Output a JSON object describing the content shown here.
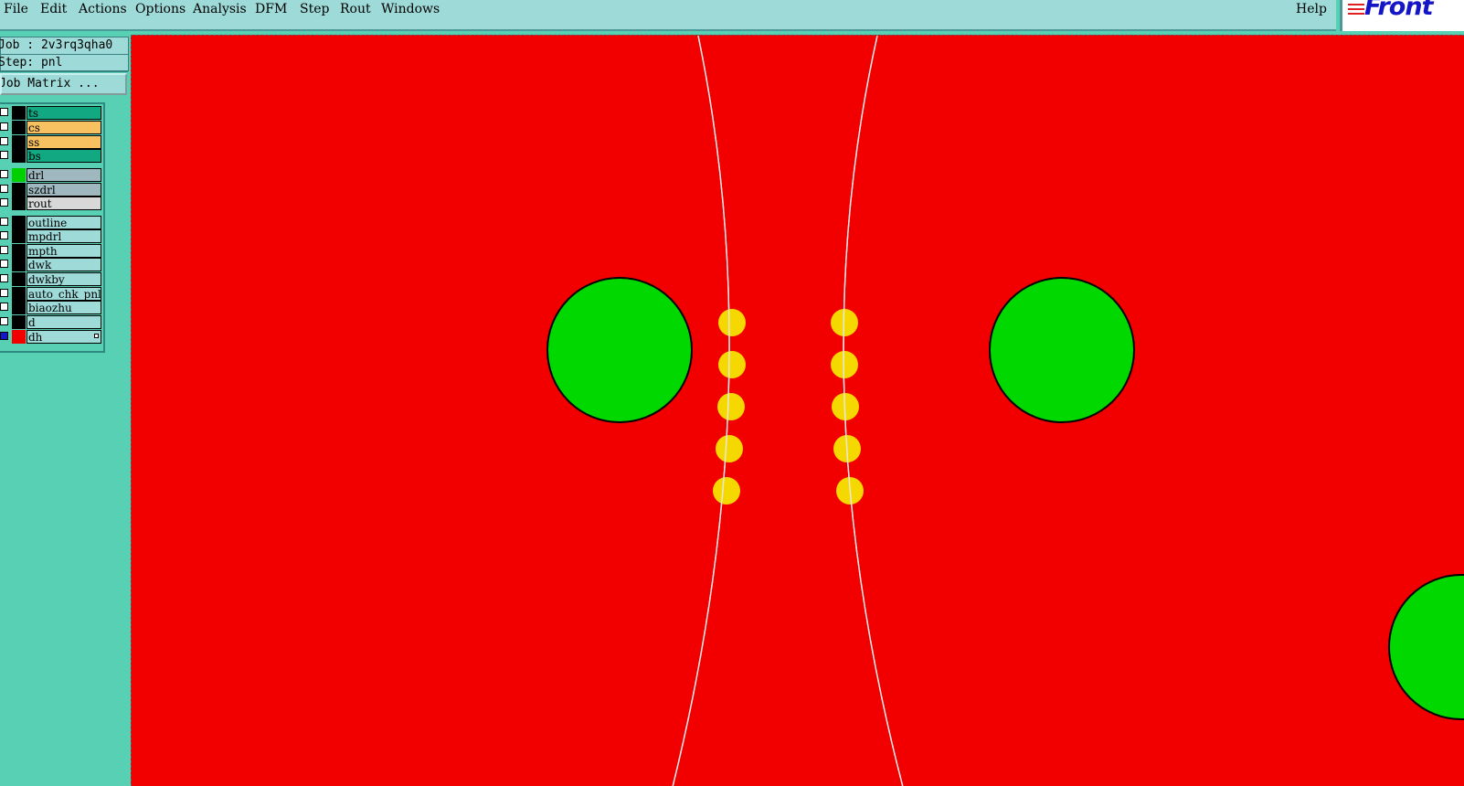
{
  "menu": {
    "file": "File",
    "edit": "Edit",
    "actions": "Actions",
    "options": "Options",
    "analysis": "Analysis",
    "dfm": "DFM",
    "step": "Step",
    "rout": "Rout",
    "windows": "Windows",
    "help": "Help"
  },
  "logo_text": "Front",
  "info": {
    "job": "Job : 2v3rq3qha0",
    "step": "Step: pnl",
    "job_matrix_button": "Job Matrix ..."
  },
  "layers": [
    {
      "name": "ts",
      "color": "#000000",
      "bg": "#11a882"
    },
    {
      "name": "cs",
      "color": "#000000",
      "bg": "#f7c060"
    },
    {
      "name": "ss",
      "color": "#000000",
      "bg": "#f7c060"
    },
    {
      "name": "bs",
      "color": "#000000",
      "bg": "#11a882"
    },
    {
      "name": "drl",
      "color": "#00d000",
      "bg": "#9fb8c0"
    },
    {
      "name": "szdrl",
      "color": "#000000",
      "bg": "#9fb8c0"
    },
    {
      "name": "rout",
      "color": "#000000",
      "bg": "#d8d8d8"
    },
    {
      "name": "outline",
      "color": "#000000",
      "bg": "#9ddad8"
    },
    {
      "name": "mpdrl",
      "color": "#000000",
      "bg": "#9ddad8"
    },
    {
      "name": "mpth",
      "color": "#000000",
      "bg": "#9ddad8"
    },
    {
      "name": "dwk",
      "color": "#000000",
      "bg": "#9ddad8"
    },
    {
      "name": "dwkby",
      "color": "#000000",
      "bg": "#9ddad8"
    },
    {
      "name": "auto_chk_pnl",
      "color": "#000000",
      "bg": "#9ddad8"
    },
    {
      "name": "biaozhu",
      "color": "#000000",
      "bg": "#9ddad8"
    },
    {
      "name": "d",
      "color": "#000000",
      "bg": "#9ddad8"
    },
    {
      "name": "dh",
      "color": "#f20000",
      "bg": "#9ddad8"
    }
  ],
  "canvas_colors": {
    "background": "#f20000",
    "big_pad": "#00d800",
    "small_pad": "#f5d800",
    "rout_line": "#e8e8e8"
  }
}
